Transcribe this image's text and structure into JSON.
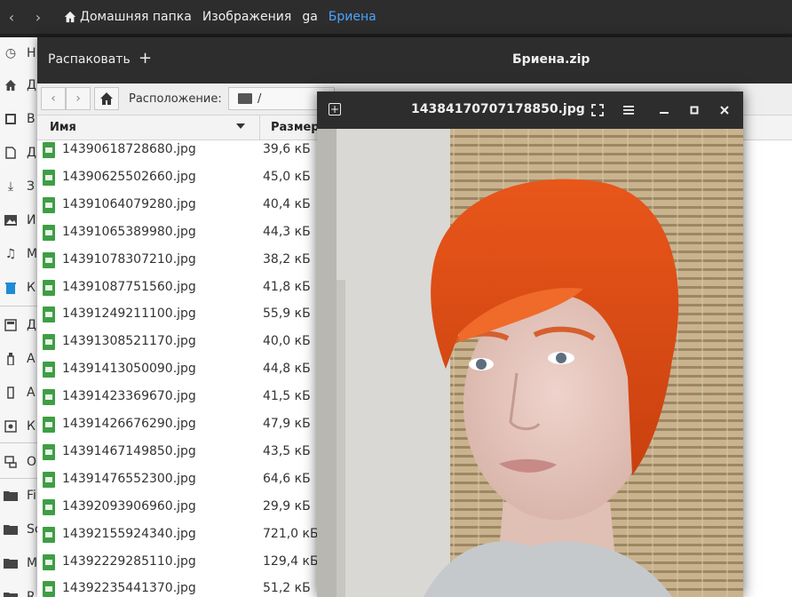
{
  "file_manager": {
    "breadcrumbs": [
      "Домашняя папка",
      "Изображения",
      "ga",
      "Бриена"
    ],
    "sidebar_letters": [
      "Н",
      "Д",
      "В",
      "Д",
      "З",
      "И",
      "М",
      "К",
      "Д",
      "А",
      "А",
      "К",
      "О",
      "Fi",
      "Sc",
      "M",
      "R"
    ]
  },
  "archive": {
    "extract_label": "Распаковать",
    "add_label": "+",
    "title": "Бриена.zip",
    "location_label": "Расположение:",
    "location_value": "/",
    "col_name": "Имя",
    "col_size": "Размер",
    "files": [
      {
        "name": "14390618728680.jpg",
        "size": "39,6 кБ"
      },
      {
        "name": "14390625502660.jpg",
        "size": "45,0 кБ"
      },
      {
        "name": "14391064079280.jpg",
        "size": "40,4 кБ"
      },
      {
        "name": "14391065389980.jpg",
        "size": "44,3 кБ"
      },
      {
        "name": "14391078307210.jpg",
        "size": "38,2 кБ"
      },
      {
        "name": "14391087751560.jpg",
        "size": "41,8 кБ"
      },
      {
        "name": "14391249211100.jpg",
        "size": "55,9 кБ"
      },
      {
        "name": "14391308521170.jpg",
        "size": "40,0 кБ"
      },
      {
        "name": "14391413050090.jpg",
        "size": "44,8 кБ"
      },
      {
        "name": "14391423369670.jpg",
        "size": "41,5 кБ"
      },
      {
        "name": "14391426676290.jpg",
        "size": "47,9 кБ"
      },
      {
        "name": "14391467149850.jpg",
        "size": "43,5 кБ"
      },
      {
        "name": "14391476552300.jpg",
        "size": "64,6 кБ"
      },
      {
        "name": "14392093906960.jpg",
        "size": "29,9 кБ"
      },
      {
        "name": "14392155924340.jpg",
        "size": "721,0 кБ"
      },
      {
        "name": "14392229285110.jpg",
        "size": "129,4 кБ"
      },
      {
        "name": "14392235441370.jpg",
        "size": "51,2 кБ"
      }
    ]
  },
  "viewer": {
    "title": "14384170707178850.jpg",
    "colors": {
      "hair": "#e0521a",
      "skin": "#e6c7bf",
      "blind": "#c9b38f",
      "wall": "#d7d6d2"
    }
  }
}
